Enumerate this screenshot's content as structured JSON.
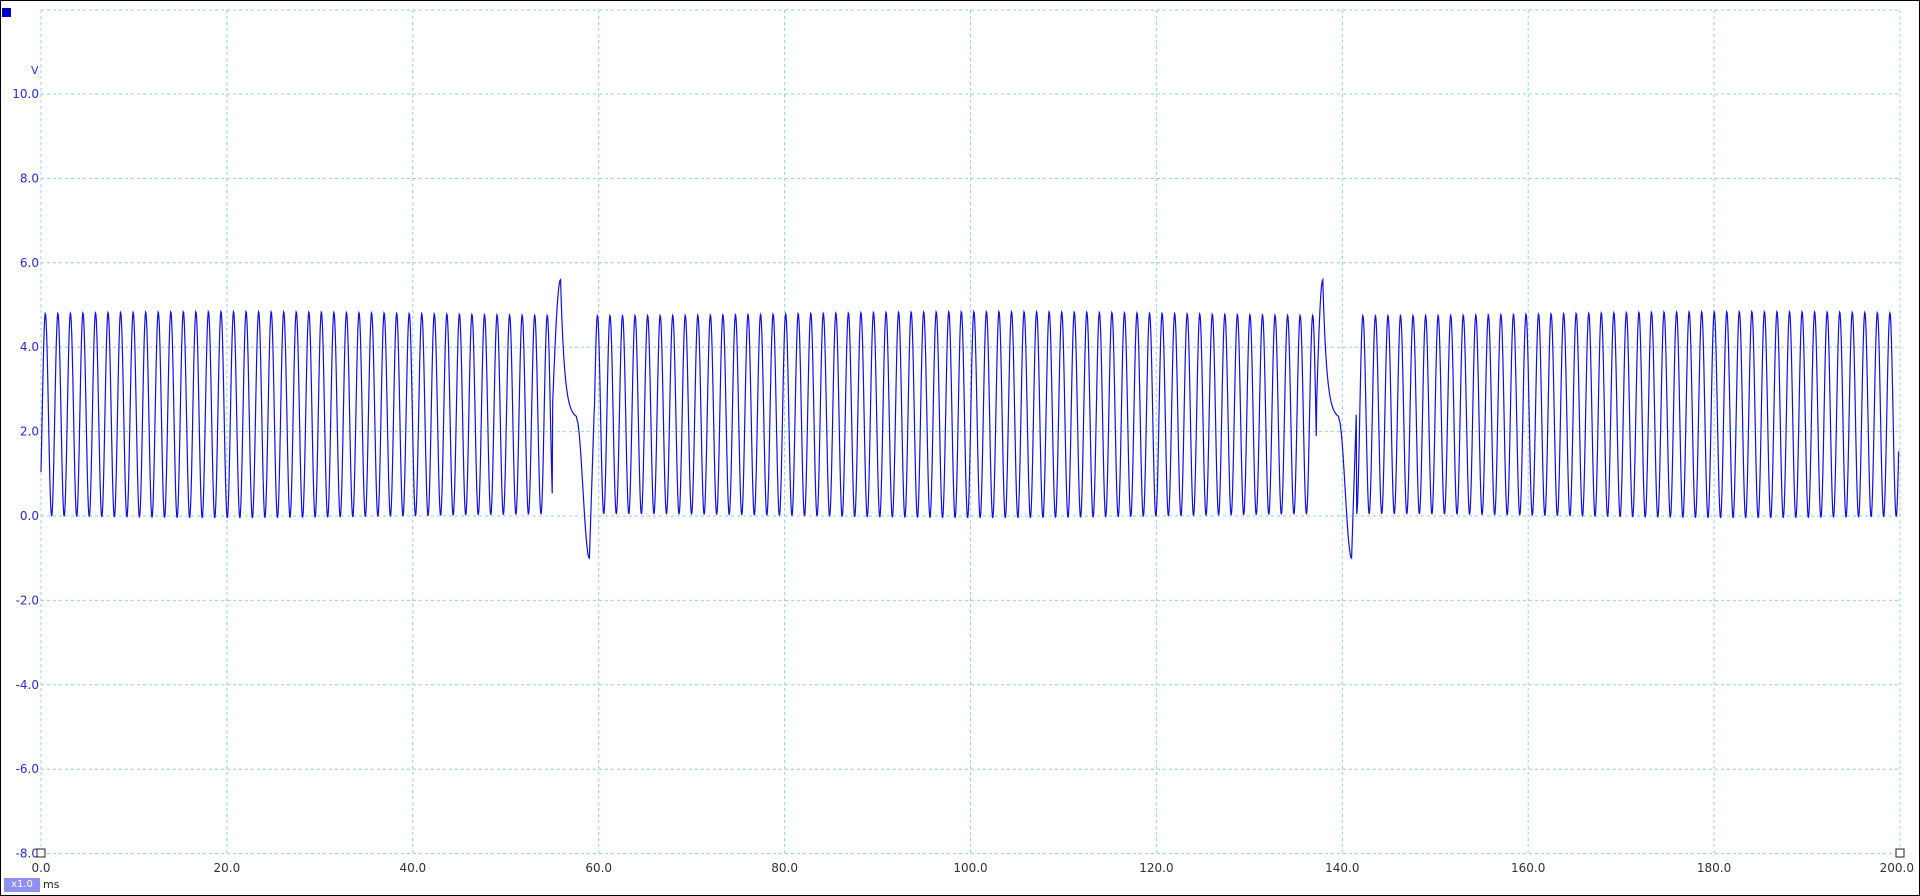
{
  "chart_data": {
    "type": "line",
    "title": "",
    "xlabel": "ms",
    "ylabel": "V",
    "xlim": [
      0,
      200
    ],
    "ylim": [
      -8,
      11.5
    ],
    "grid": true,
    "x_ticks": [
      "0.0",
      "20.0",
      "40.0",
      "60.0",
      "80.0",
      "100.0",
      "120.0",
      "140.0",
      "160.0",
      "180.0",
      "200.0"
    ],
    "y_ticks": [
      "10.0",
      "8.0",
      "6.0",
      "4.0",
      "2.0",
      "0.0",
      "-2.0",
      "-4.0",
      "-6.0",
      "-8.0"
    ],
    "series": [
      {
        "color": "#1010e0",
        "waveform": "periodic",
        "period_ms": 1.35,
        "min_v": 0.0,
        "max_v": 4.8,
        "gaps": [
          {
            "start_ms": 55.0,
            "end_ms": 59.5,
            "peak_v": 5.6,
            "peak_ms": 55.9,
            "trough_v": -1.0,
            "trough_ms": 59.0
          },
          {
            "start_ms": 137.2,
            "end_ms": 141.5,
            "peak_v": 5.6,
            "peak_ms": 137.9,
            "trough_v": -1.0,
            "trough_ms": 141.0
          }
        ]
      }
    ]
  },
  "colors": {
    "trace": "#1010e0",
    "grid": "#8fd0dc",
    "y_axis_text": "#2a2ad8"
  },
  "footer": {
    "zoom_label": "x1.0",
    "time_unit": "ms"
  },
  "y_unit": "V"
}
